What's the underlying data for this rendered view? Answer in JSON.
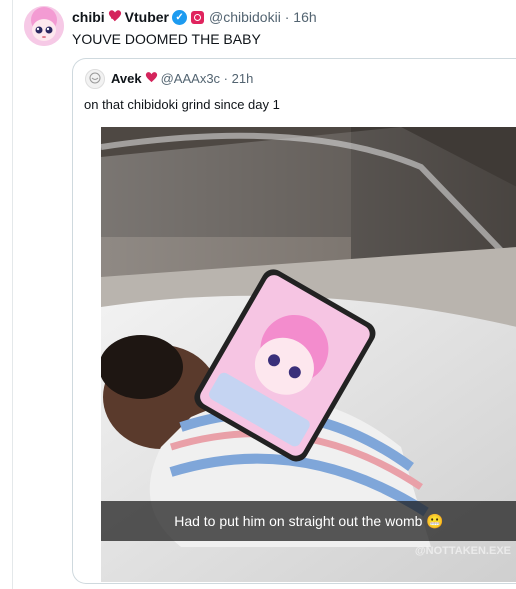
{
  "tweet": {
    "display_name": "chibi",
    "name_suffix": "Vtuber",
    "handle": "@chibidokii",
    "time": "16h",
    "text": "YOUVE DOOMED THE BABY"
  },
  "quoted": {
    "display_name": "Avek",
    "handle": "@AAAx3c",
    "time": "21h",
    "text": "on that chibidoki grind since day 1",
    "media": {
      "caption": "Had to put him on straight out the womb",
      "watermark": "@NOTTAKEN.EXE"
    }
  },
  "icons": {
    "heart": "red-heart-emoji",
    "verified": "verified-badge",
    "affiliate": "affiliate-badge",
    "caption_emoji": "grimacing-face-emoji"
  },
  "colors": {
    "text": "#0f1419",
    "muted": "#536471",
    "border": "#cfd9de",
    "verified": "#1d9bf0",
    "heart": "#e0245e"
  }
}
